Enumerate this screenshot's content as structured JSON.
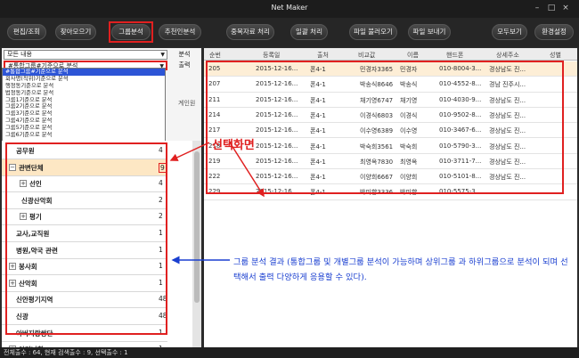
{
  "window": {
    "title": "Net Maker",
    "minimize": "–",
    "maximize": "□",
    "close": "×"
  },
  "toolbar": {
    "buttons": [
      "편집/조회",
      "찾아모으기",
      "그룹분석",
      "추천인분석",
      "중복자료 처리",
      "일괄 처리",
      "파일 불러오기",
      "파일 보내기",
      "모두보기",
      "환경설정"
    ]
  },
  "left": {
    "content_select": "모든 내용",
    "group_select": "#통합그룹#기준으로 분석",
    "analyze_button": "분석",
    "print_button": "출력",
    "dropdown_items": [
      "#통합그룹#기준으로 분석",
      "회사명(직위)기준으로 분석",
      "행정동기준으로 분석",
      "법정동기준으로 분석",
      "그룹1기준으로 분석",
      "그룹2기준으로 분석",
      "그룹3기준으로 분석",
      "그룹4기준으로 분석",
      "그룹5기준으로 분석",
      "그룹6기준으로 분석"
    ],
    "tab_label": "계인원",
    "tree": [
      {
        "label": "공무원",
        "count": "4",
        "plus": false,
        "indent": 0
      },
      {
        "label": "관변단체",
        "count": "9",
        "plus": true,
        "expanded": true,
        "indent": 0
      },
      {
        "label": "선인",
        "count": "4",
        "plus": true,
        "indent": 1
      },
      {
        "label": "신광산악회",
        "count": "2",
        "plus": false,
        "indent": 1
      },
      {
        "label": "평기",
        "count": "2",
        "plus": true,
        "indent": 1
      },
      {
        "label": "교사,교직원",
        "count": "1",
        "plus": false,
        "indent": 0
      },
      {
        "label": "병원,약국 관련",
        "count": "1",
        "plus": false,
        "indent": 0
      },
      {
        "label": "봉사회",
        "count": "1",
        "plus": true,
        "indent": 0
      },
      {
        "label": "산악회",
        "count": "1",
        "plus": true,
        "indent": 0
      },
      {
        "label": "신안평기지역",
        "count": "48",
        "plus": false,
        "indent": 0
      },
      {
        "label": "신광",
        "count": "48",
        "plus": false,
        "indent": 0
      },
      {
        "label": "아버지랑쌍단",
        "count": "1",
        "plus": false,
        "indent": 0
      },
      {
        "label": "아미니회",
        "count": "1",
        "plus": true,
        "indent": 0
      }
    ]
  },
  "table": {
    "columns": [
      "순번",
      "등록일",
      "출처",
      "비교값",
      "이름",
      "핸드폰",
      "상세주소",
      "성별"
    ],
    "rows": [
      [
        "205",
        "2015-12-16...",
        "폰4-1",
        "민경자3365",
        "민경자",
        "010-8004-3...",
        "경상남도 진...",
        ""
      ],
      [
        "207",
        "2015-12-16...",
        "폰4-1",
        "박송식8646",
        "박송식",
        "010-4552-8...",
        "경남 진주시...",
        ""
      ],
      [
        "211",
        "2015-12-16...",
        "폰4-1",
        "채기영6747",
        "채기영",
        "010-4030-9...",
        "경상남도 진...",
        ""
      ],
      [
        "214",
        "2015-12-16...",
        "폰4-1",
        "이경식6803",
        "이경식",
        "010-9502-8...",
        "경상남도 진...",
        ""
      ],
      [
        "217",
        "2015-12-16...",
        "폰4-1",
        "이수영6389",
        "이수영",
        "010-3467-6...",
        "경상남도 진...",
        ""
      ],
      [
        "218",
        "2015-12-16...",
        "폰4-1",
        "박숙희3561",
        "박숙희",
        "010-5790-3...",
        "경상남도 진...",
        ""
      ],
      [
        "219",
        "2015-12-16...",
        "폰4-1",
        "최영옥7830",
        "최영옥",
        "010-3711-7...",
        "경상남도 진...",
        ""
      ],
      [
        "222",
        "2015-12-16...",
        "폰4-1",
        "이양희6667",
        "이양희",
        "010-5101-8...",
        "경상남도 진...",
        ""
      ],
      [
        "229",
        "2015-12-16...",
        "폰4-1",
        "박미향3336",
        "박미향",
        "010-5575-3...",
        "",
        ""
      ]
    ]
  },
  "status": "전체출수 : 64, 현재 검색출수 : 9, 선택출수 : 1",
  "annotations": {
    "selection_result": "선택화면",
    "description": "그룹 분석 결과 (통합그룹 및 개별그룹 분석이 가능하며 상위그룹 과 하위그룹으로 분석이 되며 선택해서 출력 다양하게 응용할 수 있다)."
  },
  "colors": {
    "highlight": "#e02020",
    "note": "#1a3fd0",
    "selected_row": "#fdeed6",
    "dropdown_selected": "#2d55d6"
  }
}
